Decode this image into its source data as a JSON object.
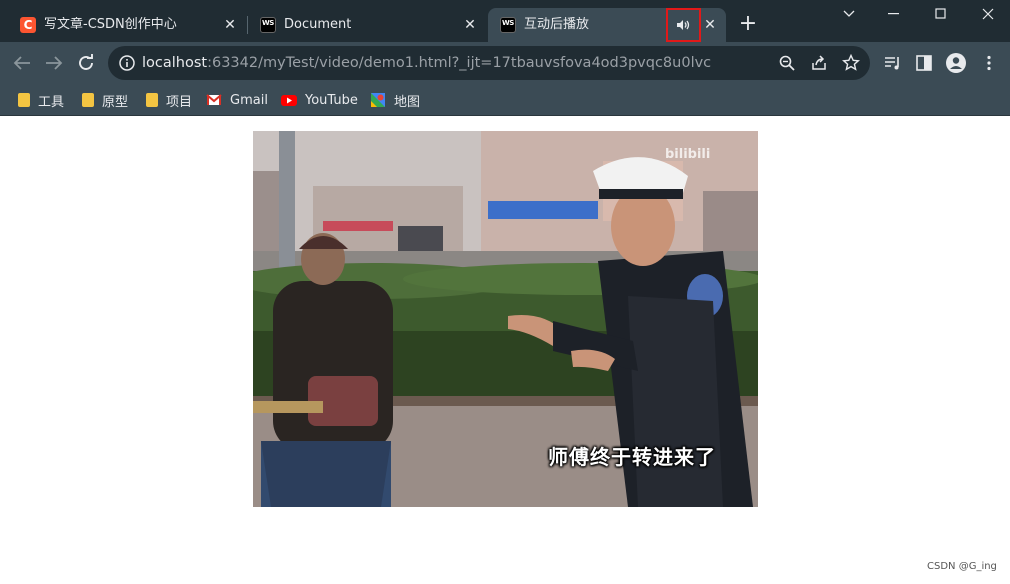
{
  "tabs": [
    {
      "title": "写文章-CSDN创作中心",
      "favicon": "C"
    },
    {
      "title": "Document",
      "favicon": "WS"
    },
    {
      "title": "互动后播放",
      "favicon": "WS",
      "active": true,
      "audio": "speaker-icon"
    }
  ],
  "tab_close": "✕",
  "new_tab": "+",
  "address": {
    "host": "localhost",
    "rest": ":63342/myTest/video/demo1.html?_ijt=17tbauvsfova4od3pvqc8u0lvc"
  },
  "bookmarks": [
    {
      "label": "工具",
      "icon": "folder-icon"
    },
    {
      "label": "原型",
      "icon": "folder-icon"
    },
    {
      "label": "项目",
      "icon": "folder-icon"
    },
    {
      "label": "Gmail",
      "icon": "gmail-icon"
    },
    {
      "label": "YouTube",
      "icon": "youtube-icon"
    },
    {
      "label": "地图",
      "icon": "maps-icon"
    }
  ],
  "video": {
    "subtitle": "师傅终于转进来了",
    "watermark": "bilibili"
  },
  "credit": "CSDN @G_ing",
  "colors": {
    "titlebar": "#202c33",
    "toolbar": "#3b4b55",
    "highlight": "#e11919"
  }
}
